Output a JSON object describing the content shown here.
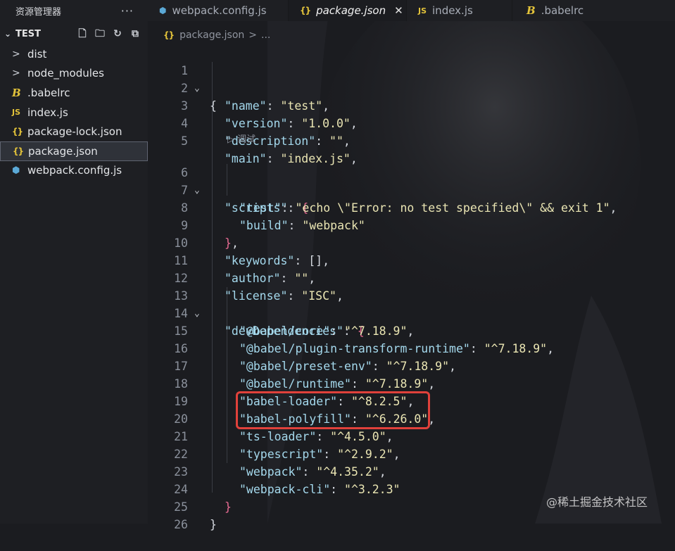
{
  "sidebar": {
    "title": "资源管理器",
    "more": "···",
    "project": "TEST",
    "items": [
      {
        "icon": "chevron-right-icon",
        "glyph": ">",
        "label": "dist"
      },
      {
        "icon": "chevron-right-icon",
        "glyph": ">",
        "label": "node_modules"
      },
      {
        "icon": "babel-icon",
        "glyph": "B",
        "label": ".babelrc"
      },
      {
        "icon": "js-icon",
        "glyph": "JS",
        "label": "index.js"
      },
      {
        "icon": "json-icon",
        "glyph": "{}",
        "label": "package-lock.json"
      },
      {
        "icon": "json-icon",
        "glyph": "{}",
        "label": "package.json"
      },
      {
        "icon": "webpack-icon",
        "glyph": "⬢",
        "label": "webpack.config.js"
      }
    ]
  },
  "tabs": [
    {
      "glyph": "⬢",
      "label": "webpack.config.js"
    },
    {
      "glyph": "{}",
      "label": "package.json",
      "close": "✕"
    },
    {
      "glyph": "JS",
      "label": "index.js"
    },
    {
      "glyph": "B",
      "label": ".babelrc"
    }
  ],
  "breadcrumb": {
    "glyph": "{}",
    "file": "package.json",
    "sep": ">",
    "rest": "..."
  },
  "codelens": "▷ 调试",
  "watermark": "@稀土掘金技术社区",
  "lines": [
    "1",
    "2",
    "3",
    "4",
    "5",
    "6",
    "7",
    "8",
    "9",
    "10",
    "11",
    "12",
    "13",
    "14",
    "15",
    "16",
    "17",
    "18",
    "19",
    "20",
    "21",
    "22",
    "23",
    "24",
    "25",
    "26"
  ],
  "code": {
    "l1": "{",
    "name_k": "\"name\"",
    "name_v": "\"test\"",
    "version_k": "\"version\"",
    "version_v": "\"1.0.0\"",
    "description_k": "\"description\"",
    "description_v": "\"\"",
    "main_k": "\"main\"",
    "main_v": "\"index.js\"",
    "scripts_k": "\"scripts\"",
    "open_brace": "{",
    "test_k": "\"test\"",
    "test_v": "\"echo \\\"Error: no test specified\\\" && exit 1\"",
    "build_k": "\"build\"",
    "build_v": "\"webpack\"",
    "close_brace": "}",
    "keywords_k": "\"keywords\"",
    "keywords_v": "[]",
    "author_k": "\"author\"",
    "author_v": "\"\"",
    "license_k": "\"license\"",
    "license_v": "\"ISC\"",
    "devdeps_k": "\"devDependencies\"",
    "d1_k": "\"@babel/core\"",
    "d1_v": "\"^7.18.9\"",
    "d2_k": "\"@babel/plugin-transform-runtime\"",
    "d2_v": "\"^7.18.9\"",
    "d3_k": "\"@babel/preset-env\"",
    "d3_v": "\"^7.18.9\"",
    "d4_k": "\"@babel/runtime\"",
    "d4_v": "\"^7.18.9\"",
    "d5_k": "\"babel-loader\"",
    "d5_v": "\"^8.2.5\"",
    "d6_k": "\"babel-polyfill\"",
    "d6_v": "\"^6.26.0\"",
    "d7_k": "\"ts-loader\"",
    "d7_v": "\"^4.5.0\"",
    "d8_k": "\"typescript\"",
    "d8_v": "\"^2.9.2\"",
    "d9_k": "\"webpack\"",
    "d9_v": "\"^4.35.2\"",
    "d10_k": "\"webpack-cli\"",
    "d10_v": "\"^3.2.3\"",
    "end": "}"
  }
}
